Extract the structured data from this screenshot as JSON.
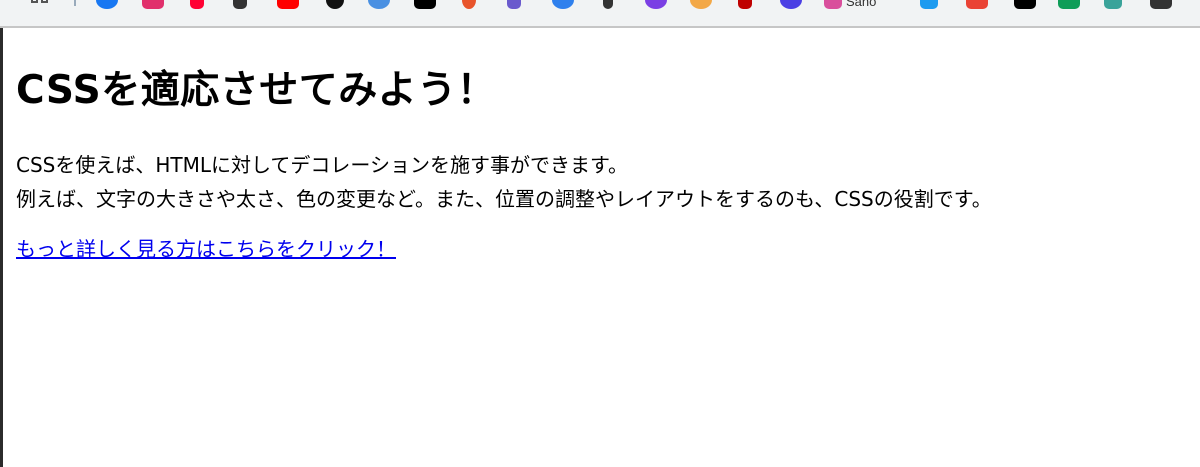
{
  "bookmarks_bar": {
    "items": [
      {
        "icon": "facebook-icon",
        "color": "#1877f2"
      },
      {
        "icon": "instagram-icon",
        "color": "#e1306c"
      },
      {
        "icon": "yahoo-icon",
        "color": "#ff0033"
      },
      {
        "icon": "tool-icon",
        "color": "#333333"
      },
      {
        "icon": "youtube-icon",
        "color": "#ff0000"
      },
      {
        "icon": "tiktok-icon",
        "color": "#111111"
      },
      {
        "icon": "shield-icon",
        "color": "#4a90e2"
      },
      {
        "icon": "threads-icon",
        "color": "#000000"
      },
      {
        "icon": "burst-icon",
        "color": "#e8542b"
      },
      {
        "icon": "pen-icon",
        "color": "#6a5acd"
      },
      {
        "icon": "q-icon",
        "color": "#2f80ed"
      },
      {
        "icon": "dots-icon",
        "color": "#333333"
      },
      {
        "icon": "purple-circle-icon",
        "color": "#7b3fe4"
      },
      {
        "icon": "amazon-icon",
        "color": "#f3a847"
      },
      {
        "icon": "rakuten-icon",
        "color": "#bf0000"
      },
      {
        "icon": "blue-circle-icon",
        "color": "#4b3fe4"
      },
      {
        "icon": "flower-icon",
        "color": "#d94f9c"
      },
      {
        "icon": "twitter-icon",
        "color": "#1d9bf0"
      },
      {
        "icon": "gmail-icon",
        "color": "#ea4335"
      },
      {
        "icon": "notion-icon",
        "color": "#000000"
      },
      {
        "icon": "sheets-icon",
        "color": "#0f9d58"
      },
      {
        "icon": "teal-icon",
        "color": "#3aa39a"
      },
      {
        "icon": "camera-icon",
        "color": "#333333"
      }
    ],
    "partial_text": "Sano"
  },
  "page": {
    "heading": "CSSを適応させてみよう！",
    "paragraph_line1": "CSSを使えば、HTMLに対してデコレーションを施す事ができます。",
    "paragraph_line2": "例えば、文字の大きさや太さ、色の変更など。また、位置の調整やレイアウトをするのも、CSSの役割です。",
    "link_text": "もっと詳しく見る方はこちらをクリック！",
    "link_color": "#0000ee"
  }
}
